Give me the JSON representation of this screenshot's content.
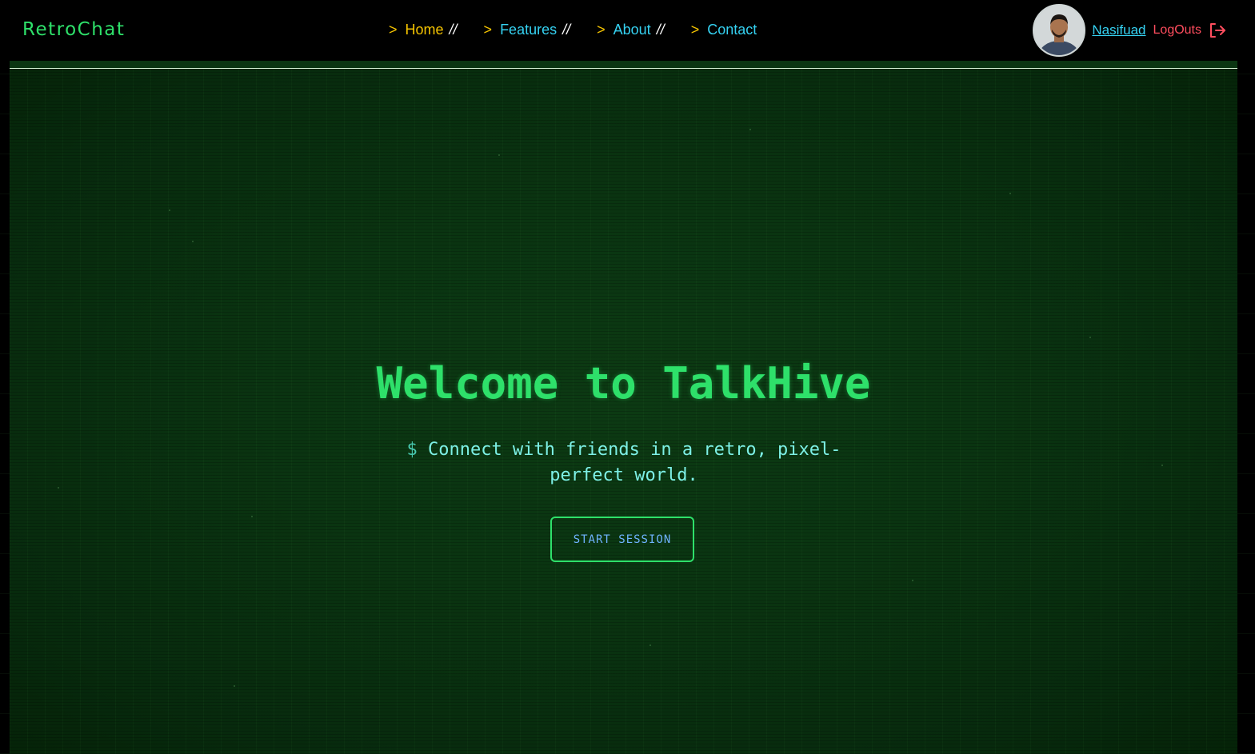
{
  "navbar": {
    "brand": "RetroChat",
    "links": [
      {
        "prompt": ">",
        "label": "Home",
        "separator": "//",
        "active": true
      },
      {
        "prompt": ">",
        "label": "Features",
        "separator": "//",
        "active": false
      },
      {
        "prompt": ">",
        "label": "About",
        "separator": "//",
        "active": false
      },
      {
        "prompt": ">",
        "label": "Contact",
        "separator": "",
        "active": false
      }
    ],
    "user": {
      "name": "Nasifuad",
      "logout_label": "LogOuts",
      "avatar_icon": "user-avatar",
      "logout_icon": "logout-icon"
    }
  },
  "hero": {
    "title": "Welcome to TalkHive",
    "subtitle_prefix": "$",
    "subtitle": "Connect with friends in a retro, pixel-perfect world.",
    "cta_label": "START SESSION"
  },
  "colors": {
    "brand_green": "#2ee06a",
    "link_cyan": "#35d2f2",
    "active_yellow": "#f5c400",
    "logout_red": "#ff4d5e",
    "background_green": "#0a3411"
  }
}
